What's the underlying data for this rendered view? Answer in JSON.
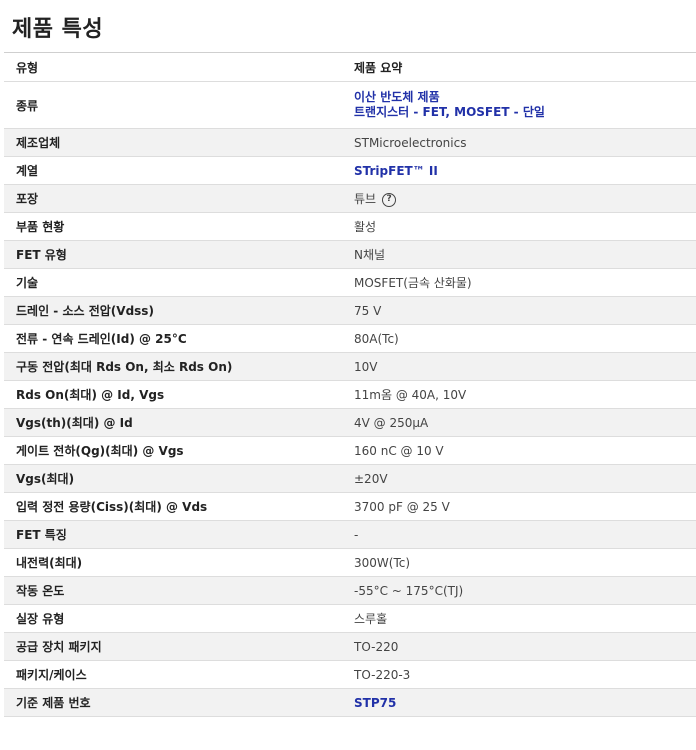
{
  "title": "제품 특성",
  "header": {
    "type": "유형",
    "summary": "제품 요약"
  },
  "rows": [
    {
      "label": "종류",
      "value_lines": [
        "이산 반도체 제품",
        "트랜지스터 - FET, MOSFET - 단일"
      ]
    },
    {
      "label": "제조업체",
      "value": "STMicroelectronics"
    },
    {
      "label": "계열",
      "value": "STripFET™ II"
    },
    {
      "label": "포장",
      "value": "튜브",
      "help_icon": "?"
    },
    {
      "label": "부품 현황",
      "value": "활성"
    },
    {
      "label": "FET 유형",
      "value": "N채널"
    },
    {
      "label": "기술",
      "value": "MOSFET(금속 산화물)"
    },
    {
      "label": "드레인 - 소스 전압(Vdss)",
      "value": "75 V"
    },
    {
      "label": "전류 - 연속 드레인(Id) @ 25°C",
      "value": "80A(Tc)"
    },
    {
      "label": "구동 전압(최대 Rds On, 최소 Rds On)",
      "value": "10V"
    },
    {
      "label": "Rds On(최대) @ Id, Vgs",
      "value": "11m옴 @ 40A, 10V"
    },
    {
      "label": "Vgs(th)(최대) @ Id",
      "value": "4V @ 250µA"
    },
    {
      "label": "게이트 전하(Qg)(최대) @ Vgs",
      "value": "160 nC @ 10 V"
    },
    {
      "label": "Vgs(최대)",
      "value": "±20V"
    },
    {
      "label": "입력 정전 용량(Ciss)(최대) @ Vds",
      "value": "3700 pF @ 25 V"
    },
    {
      "label": "FET 특징",
      "value": "-"
    },
    {
      "label": "내전력(최대)",
      "value": "300W(Tc)"
    },
    {
      "label": "작동 온도",
      "value": "-55°C ~ 175°C(TJ)"
    },
    {
      "label": "실장 유형",
      "value": "스루홀"
    },
    {
      "label": "공급 장치 패키지",
      "value": "TO-220"
    },
    {
      "label": "패키지/케이스",
      "value": "TO-220-3"
    },
    {
      "label": "기준 제품 번호",
      "value": "STP75"
    }
  ],
  "colors": {
    "link": "#2131a8",
    "shade": "#f2f2f2"
  }
}
